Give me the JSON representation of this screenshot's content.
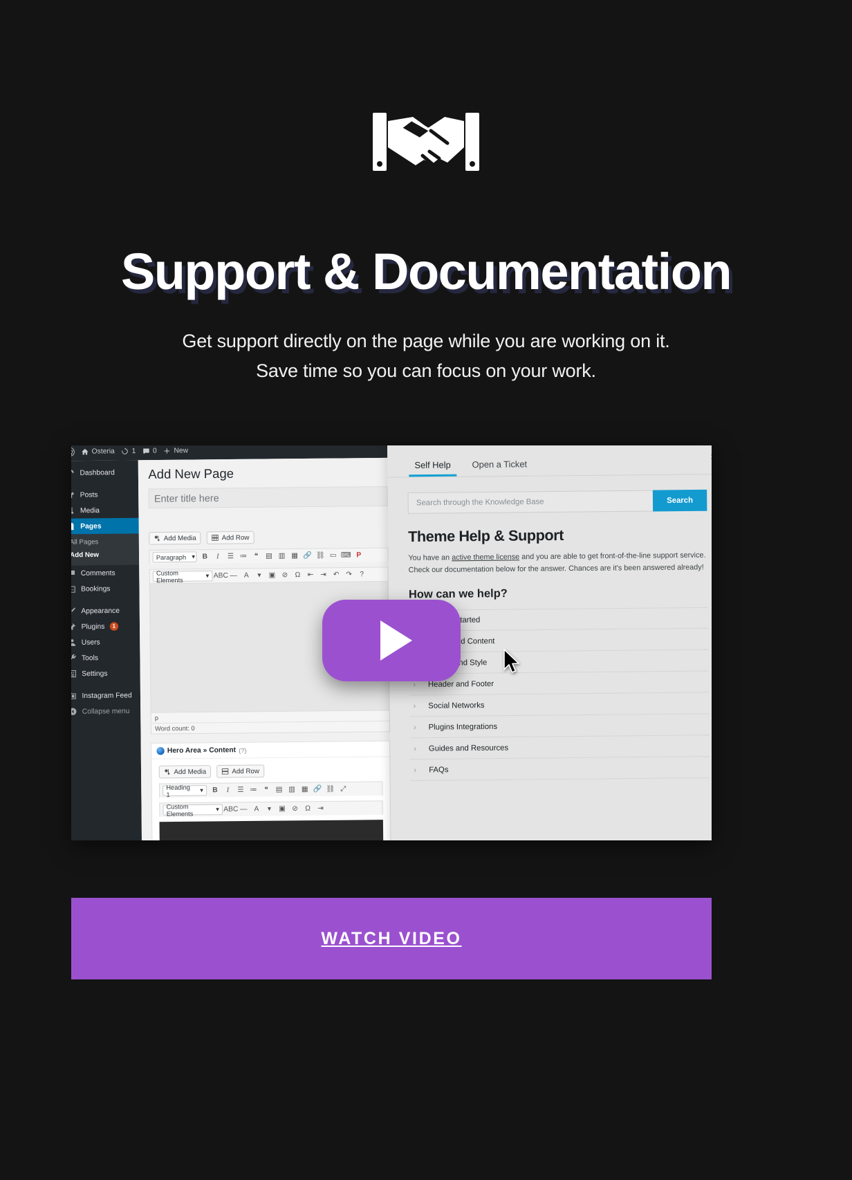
{
  "hero": {
    "icon": "handshake-icon",
    "title": "Support & Documentation",
    "subtitle_line1": "Get support directly on the page while you are working on it.",
    "subtitle_line2": "Save time so you can focus on your work."
  },
  "cta": {
    "label": "WATCH VIDEO",
    "color": "#9b51cf"
  },
  "video": {
    "play_icon": "play-icon"
  },
  "screenshot": {
    "wp_adminbar": {
      "logo": "wordpress-icon",
      "site_name": "Osteria",
      "updates_count": "1",
      "comments_count": "0",
      "new_label": "New"
    },
    "wp_sidebar": {
      "items": [
        {
          "label": "Dashboard",
          "icon": "dashboard-icon",
          "active": false
        },
        {
          "label": "Posts",
          "icon": "pin-icon",
          "active": false
        },
        {
          "label": "Media",
          "icon": "media-icon",
          "active": false
        },
        {
          "label": "Pages",
          "icon": "pages-icon",
          "active": true
        },
        {
          "label": "Comments",
          "icon": "comment-icon",
          "active": false
        },
        {
          "label": "Bookings",
          "icon": "calendar-icon",
          "active": false
        },
        {
          "label": "Appearance",
          "icon": "brush-icon",
          "active": false
        },
        {
          "label": "Plugins",
          "icon": "plug-icon",
          "active": false,
          "badge": "1"
        },
        {
          "label": "Users",
          "icon": "user-icon",
          "active": false
        },
        {
          "label": "Tools",
          "icon": "wrench-icon",
          "active": false
        },
        {
          "label": "Settings",
          "icon": "settings-icon",
          "active": false
        },
        {
          "label": "Instagram Feed",
          "icon": "camera-icon",
          "active": false
        },
        {
          "label": "Collapse menu",
          "icon": "collapse-icon",
          "active": false
        }
      ],
      "pages_submenu": [
        {
          "label": "All Pages",
          "current": false
        },
        {
          "label": "Add New",
          "current": true
        }
      ]
    },
    "wp_editor": {
      "page_title": "Add New Page",
      "title_placeholder": "Enter title here",
      "add_media_label": "Add Media",
      "add_row_label": "Add Row",
      "format_select": "Paragraph",
      "custom_elements_select": "Custom Elements",
      "path_indicator": "p",
      "word_count": "Word count: 0",
      "metabox_title": "Hero Area » Content",
      "metabox_hint": "(?)",
      "metabox_add_media": "Add Media",
      "metabox_add_row": "Add Row",
      "metabox_format_select": "Heading 1",
      "metabox_custom_elements": "Custom Elements"
    },
    "support_panel": {
      "tabs": [
        {
          "label": "Self Help",
          "active": true
        },
        {
          "label": "Open a Ticket",
          "active": false
        }
      ],
      "close_label": "×",
      "search_placeholder": "Search through the Knowledge Base",
      "search_button": "Search",
      "heading": "Theme Help & Support",
      "paragraph_pre": "You have an ",
      "paragraph_link": "active theme license",
      "paragraph_post": " and you are able to get front-of-the-line support service.  Check our documentation below for the answer. Chances are it's been answered already!",
      "subheading": "How can we help?",
      "accordion": [
        "Getting Started",
        "Pages and Content",
        "Design and Style",
        "Header and Footer",
        "Social Networks",
        "Plugins Integrations",
        "Guides and Resources",
        "FAQs"
      ],
      "accent_color": "#139bd0"
    }
  }
}
